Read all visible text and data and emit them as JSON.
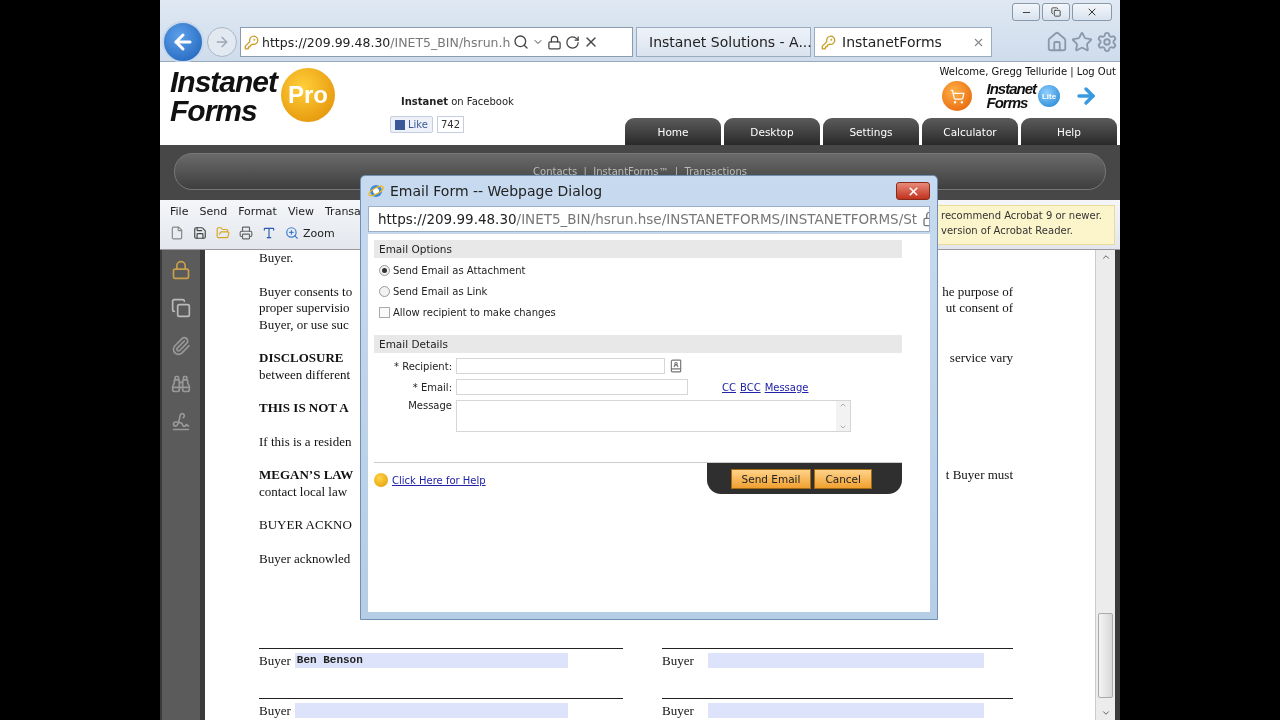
{
  "browser": {
    "address": {
      "host": "https://209.99.48.30",
      "path": "/INET5_BIN/hsrun.h"
    },
    "tabs": [
      {
        "kind": "ie",
        "label": "Instanet Solutions - A...",
        "selected": false
      },
      {
        "kind": "site",
        "label": "InstanetForms",
        "selected": true
      }
    ]
  },
  "site": {
    "logo": {
      "line1": "Instanet",
      "line2": "Forms",
      "badge": "Pro"
    },
    "facebook": {
      "brand": "Instanet",
      "text": "on Facebook",
      "like": "Like",
      "count": "742"
    },
    "welcome": "Welcome, Gregg Telluride | Log Out",
    "mini_logo": {
      "line1": "Instanet",
      "line2": "Forms",
      "badge": "Lite"
    },
    "nav": [
      {
        "label": "Home"
      },
      {
        "label": "Desktop"
      },
      {
        "label": "Settings"
      },
      {
        "label": "Calculator"
      },
      {
        "label": "Help"
      }
    ],
    "subnav": "Contacts  |  InstantForms™  |  Transactions"
  },
  "reader": {
    "menu": [
      "File",
      "Send",
      "Format",
      "View",
      "Transa"
    ],
    "zoom": "Zoom",
    "notice": [
      "recommend Acrobat 9 or newer.",
      "version of Acrobat Reader."
    ]
  },
  "document": {
    "paragraphs": [
      {
        "lines": [
          {
            "left": "Buyer.",
            "bold": false
          }
        ]
      },
      {
        "lines": [
          {
            "left": "Buyer consents to",
            "right": "he purpose of",
            "bold": false
          },
          {
            "left": "proper supervisio",
            "right": "ut consent of",
            "bold": false
          },
          {
            "left": "Buyer, or use suc",
            "bold": false
          }
        ]
      },
      {
        "lines": [
          {
            "left": "DISCLOSURE",
            "right": "service  vary",
            "bold": true
          },
          {
            "left": "between different",
            "bold": false
          }
        ]
      },
      {
        "lines": [
          {
            "left": "THIS IS NOT A",
            "bold": true
          }
        ]
      },
      {
        "lines": [
          {
            "left": "If this is a residen",
            "bold": false
          }
        ]
      },
      {
        "lines": [
          {
            "left": "MEGAN’S LAW",
            "right": "t Buyer must",
            "bold": true
          },
          {
            "left": "contact local law",
            "bold": false
          }
        ]
      },
      {
        "lines": [
          {
            "left": "BUYER ACKNO",
            "bold": false
          }
        ]
      },
      {
        "lines": [
          {
            "left": "Buyer acknowled",
            "bold": false
          }
        ]
      }
    ],
    "signatures": [
      {
        "left": {
          "label": "Buyer",
          "value": "Ben Benson"
        },
        "right": {
          "label": "Buyer"
        }
      },
      {
        "left": {
          "label": "Buyer"
        },
        "right": {
          "label": "Buyer"
        }
      }
    ]
  },
  "dialog": {
    "title": "Email Form -- Webpage Dialog",
    "url_host": "https://209.99.48.30",
    "url_path": "/INET5_BIN/hsrun.hse/INSTANETFORMS/INSTANETFORMS/St",
    "options_heading": "Email Options",
    "options": [
      {
        "kind": "radio",
        "label": "Send Email as Attachment",
        "selected": true
      },
      {
        "kind": "radio",
        "label": "Send Email as Link",
        "selected": false
      },
      {
        "kind": "checkbox",
        "label": "Allow recipient to make changes",
        "checked": false
      }
    ],
    "details_heading": "Email Details",
    "fields": [
      {
        "kind": "lookup",
        "label": "* Recipient:"
      },
      {
        "kind": "input",
        "label": "* Email:",
        "links": [
          "CC",
          "BCC",
          "Message"
        ]
      },
      {
        "kind": "textarea",
        "label": "Message"
      }
    ],
    "help": "Click Here for Help",
    "buttons": [
      {
        "label": "Send Email"
      },
      {
        "label": "Cancel"
      }
    ]
  }
}
